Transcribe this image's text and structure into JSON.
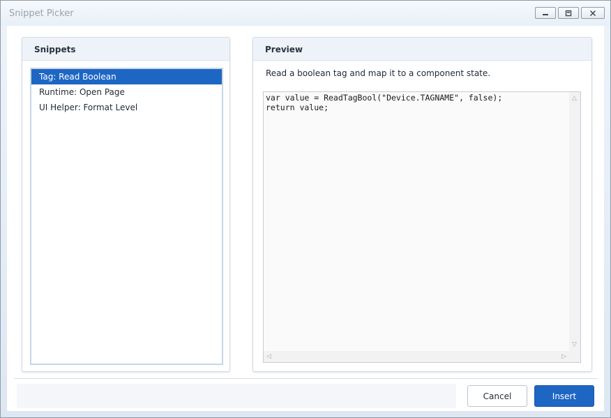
{
  "window": {
    "title": "Snippet Picker"
  },
  "snippets": {
    "header": "Snippets",
    "items": [
      {
        "label": "Tag: Read Boolean",
        "selected": true
      },
      {
        "label": "Runtime: Open Page",
        "selected": false
      },
      {
        "label": "UI Helper: Format Level",
        "selected": false
      }
    ]
  },
  "preview": {
    "header": "Preview",
    "description": "Read a boolean tag and map it to a component state.",
    "code": "var value = ReadTagBool(\"Device.TAGNAME\", false);\nreturn value;"
  },
  "footer": {
    "cancel_label": "Cancel",
    "insert_label": "Insert"
  },
  "colors": {
    "accent": "#1e66c4",
    "selected_text": "#ffffff"
  }
}
